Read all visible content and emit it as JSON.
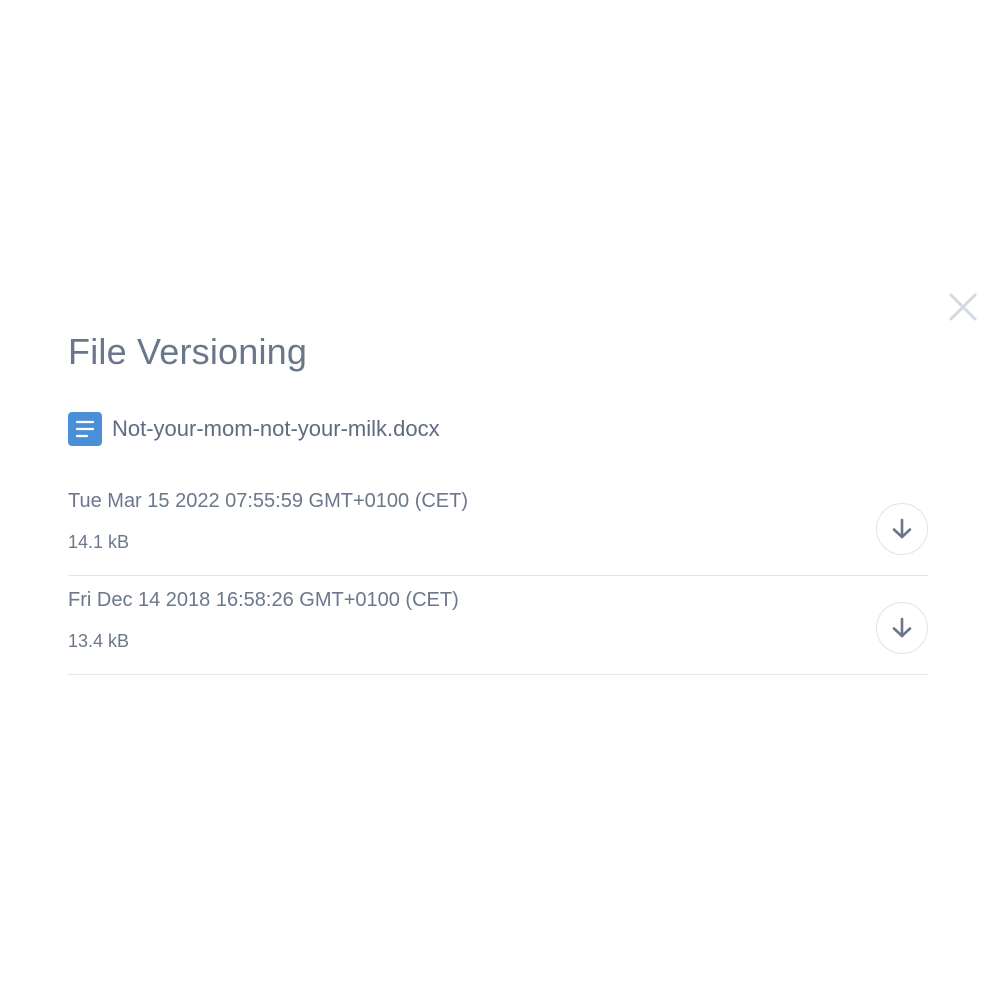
{
  "dialog": {
    "title": "File Versioning",
    "close_icon": "close-icon",
    "file": {
      "icon": "document-icon",
      "icon_color": "#4a90d9",
      "name": "Not-your-mom-not-your-milk.docx"
    },
    "versions": [
      {
        "date": "Tue Mar 15 2022 07:55:59 GMT+0100 (CET)",
        "size": "14.1 kB",
        "action_icon": "download-arrow-icon"
      },
      {
        "date": "Fri Dec 14 2018 16:58:26 GMT+0100 (CET)",
        "size": "13.4 kB",
        "action_icon": "download-arrow-icon"
      }
    ]
  },
  "colors": {
    "text": "#6b778c",
    "divider": "#e1e5ec",
    "accent": "#4a90d9"
  }
}
